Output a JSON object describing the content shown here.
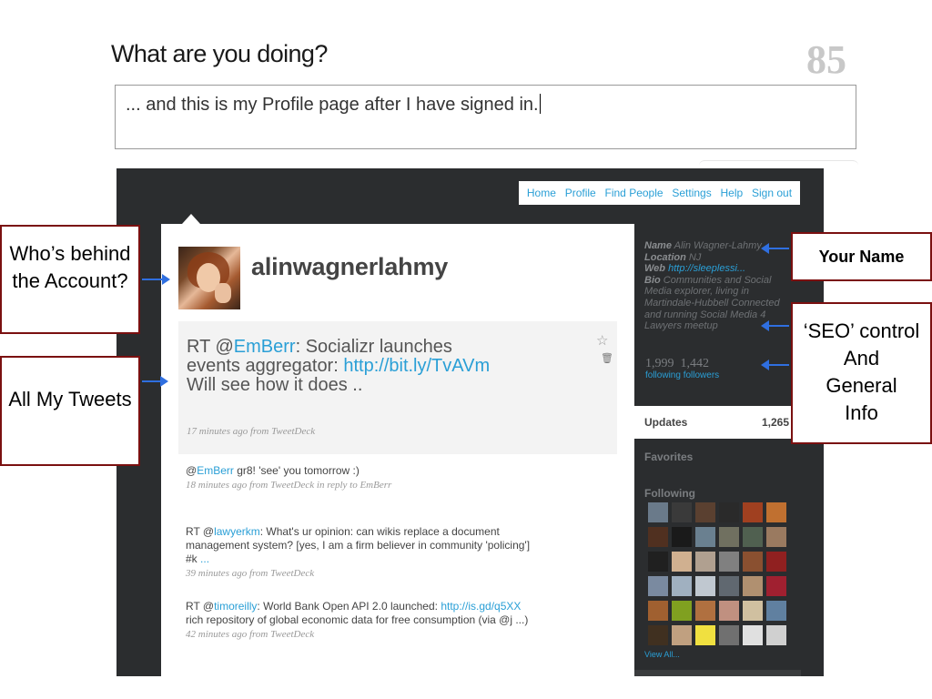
{
  "compose": {
    "title": "What are you doing?",
    "counter": "85",
    "text": "... and this is my Profile page after I have signed in."
  },
  "nav": [
    "Home",
    "Profile",
    "Find People",
    "Settings",
    "Help",
    "Sign out"
  ],
  "profile": {
    "username": "alinwagnerlahmy",
    "name_label": "Name",
    "name": "Alin Wagner-Lahmy",
    "location_label": "Location",
    "location": "NJ",
    "web_label": "Web",
    "web": "http://sleeplessi...",
    "bio_label": "Bio",
    "bio": "Communities and Social Media explorer, living in Martindale-Hubbell Connected and running Social Media 4 Lawyers meetup"
  },
  "stats": {
    "following_count": "1,999",
    "followers_count": "1,442",
    "following_label": "following",
    "followers_label": "followers"
  },
  "sidebar": {
    "updates_label": "Updates",
    "updates_count": "1,265",
    "favorites_label": "Favorites",
    "following_title": "Following",
    "view_all": "View All..."
  },
  "latest_tweet": {
    "prefix": "RT @",
    "mention": "EmBerr",
    "text1": ": Socializr launches events aggregator: ",
    "link": "http://bit.ly/TvAVm",
    "text2": " Will see how it does ..",
    "meta": "17 minutes ago from TweetDeck"
  },
  "tweets": [
    {
      "prefix": "@",
      "mention": "EmBerr",
      "text": " gr8! 'see' you tomorrow :)",
      "link": "",
      "text2": "",
      "meta": "18 minutes ago from TweetDeck in reply to EmBerr"
    },
    {
      "prefix": "RT @",
      "mention": "lawyerkm",
      "text": ": What's ur opinion: can wikis replace a document management system? [yes, I am a firm believer in community 'policing'] #k",
      "link": " ...",
      "text2": "",
      "meta": "39 minutes ago from TweetDeck"
    },
    {
      "prefix": "RT @",
      "mention": "timoreilly",
      "text": ": World Bank Open API 2.0 launched: ",
      "link": "http://is.gd/q5XX",
      "text2": " rich repository of global economic data for free consumption (via @j ...)",
      "meta": "42 minutes ago from TweetDeck"
    }
  ],
  "callouts": {
    "who": "Who’s behind the Account?",
    "tweets": "All My Tweets",
    "name": "Your Name",
    "seo_1": "‘SEO’ control",
    "seo_2": "And",
    "seo_3": "General",
    "seo_4": "Info"
  },
  "icons": {
    "star": "star-icon",
    "trash": "trash-icon",
    "arrow": "arrow-icon"
  },
  "colors": {
    "accent": "#2a9fd6",
    "dark_bg": "#2b2d2f",
    "callout_border": "#7a1010",
    "arrow": "#2f6fe0"
  },
  "following_avatars": [
    "#6a7a8a",
    "#3a3a3a",
    "#5a4030",
    "#2a2a2a",
    "#a04020",
    "#c07030",
    "#503020",
    "#1a1a1a",
    "#6a8090",
    "#707060",
    "#506050",
    "#9a7a60",
    "#202020",
    "#d0b090",
    "#b0a090",
    "#808080",
    "#8a5030",
    "#902020",
    "#7a8aa0",
    "#a0b0c0",
    "#c0c8d0",
    "#606870",
    "#b09070",
    "#a02030",
    "#a06030",
    "#80a020",
    "#b07040",
    "#c09080",
    "#d0c0a0",
    "#6080a0",
    "#403020",
    "#c0a080",
    "#f0e040",
    "#707070",
    "#e0e0e0",
    "#d0d0d0"
  ]
}
